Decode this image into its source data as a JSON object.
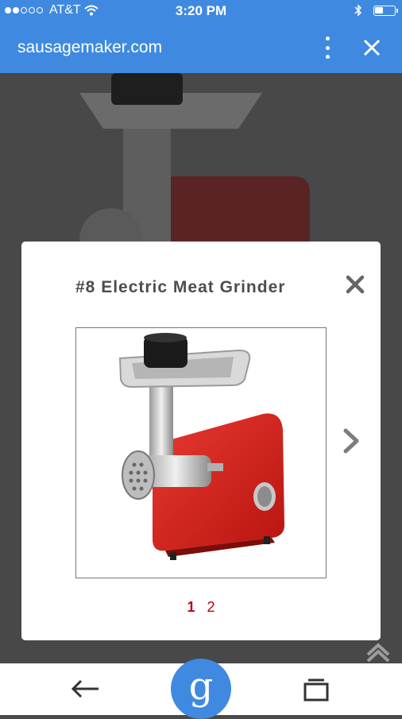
{
  "status_bar": {
    "carrier": "AT&T",
    "time": "3:20 PM",
    "signal_bars_filled": 2,
    "signal_bars_total": 5
  },
  "browser": {
    "domain": "sausagemaker.com",
    "accent_color": "#3f8ae0"
  },
  "modal": {
    "title": "#8 Electric Meat Grinder",
    "pages": [
      "1",
      "2"
    ],
    "active_page": "1",
    "image_alt_name": "electric-meat-grinder-image"
  },
  "bottom_bar": {
    "search_button_letter": "g"
  },
  "icons": {
    "wifi": "wifi-icon",
    "bluetooth": "bluetooth-icon",
    "battery": "battery-icon",
    "menu": "kebab-menu-icon",
    "close": "close-icon",
    "next": "chevron-right-icon",
    "scroll_top": "chevron-up-icon",
    "back": "back-arrow-icon",
    "tabs": "tabs-icon"
  }
}
